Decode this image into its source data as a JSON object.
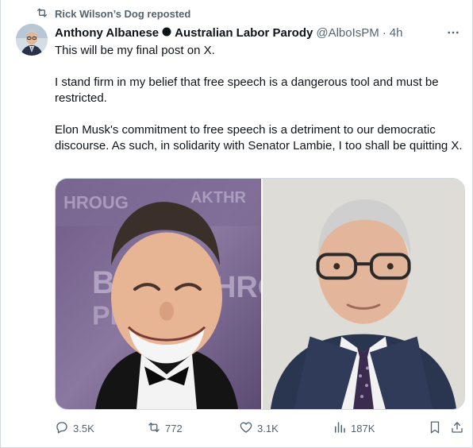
{
  "repost": {
    "text": "Rick Wilson’s Dog reposted",
    "icon": "repost-icon"
  },
  "author": {
    "display_name": "Anthony Albanese",
    "separator_icon": "black-circle-icon",
    "parody_label": "Australian Labor Parody",
    "handle": "@AlboIsPM",
    "dot": "·",
    "time": "4h"
  },
  "more": {
    "icon": "more-horizontal-icon"
  },
  "tweet": {
    "paragraphs": [
      "This will be my final post on X.",
      "I stand firm in my belief that free speech is a dangerous tool and must be restricted.",
      "Elon Musk's commitment to free speech is a detriment to our democratic discourse. As such, in solidarity with Senator Lambie, I too shall be quitting X."
    ]
  },
  "media": {
    "left_image": "photo-laughing-man-tuxedo",
    "right_image": "photo-man-glasses-suit"
  },
  "actions": {
    "reply": {
      "icon": "reply-icon",
      "count": "3.5K"
    },
    "repost": {
      "icon": "repost-icon",
      "count": "772"
    },
    "like": {
      "icon": "heart-icon",
      "count": "3.1K"
    },
    "views": {
      "icon": "views-icon",
      "count": "187K"
    },
    "bookmark": {
      "icon": "bookmark-icon"
    },
    "share": {
      "icon": "share-icon"
    }
  },
  "colors": {
    "text_primary": "#0f1419",
    "text_secondary": "#536471",
    "border": "#cfd9de"
  }
}
